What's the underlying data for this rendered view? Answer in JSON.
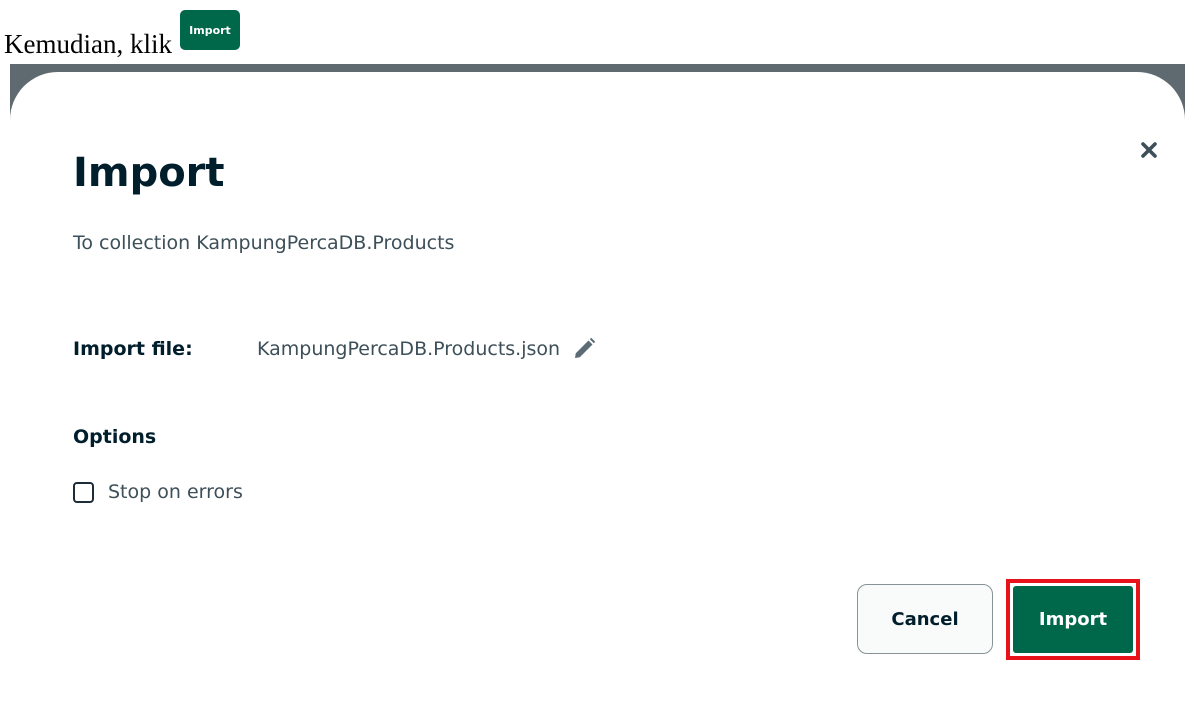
{
  "instruction": {
    "text": "Kemudian, klik",
    "inline_button_label": "Import"
  },
  "modal": {
    "title": "Import",
    "subtitle": "To collection KampungPercaDB.Products",
    "file_label": "Import file:",
    "file_name": "KampungPercaDB.Products.json",
    "options_heading": "Options",
    "stop_on_errors_label": "Stop on errors",
    "stop_on_errors_checked": false,
    "cancel_label": "Cancel",
    "import_label": "Import",
    "icons": {
      "close": "close-icon",
      "edit": "pencil-icon"
    }
  },
  "colors": {
    "primary_green": "#00684a",
    "highlight_red": "#e8121a",
    "heading_text": "#001e2b",
    "body_text": "#3d4f58",
    "backdrop": "#5f6a70"
  }
}
